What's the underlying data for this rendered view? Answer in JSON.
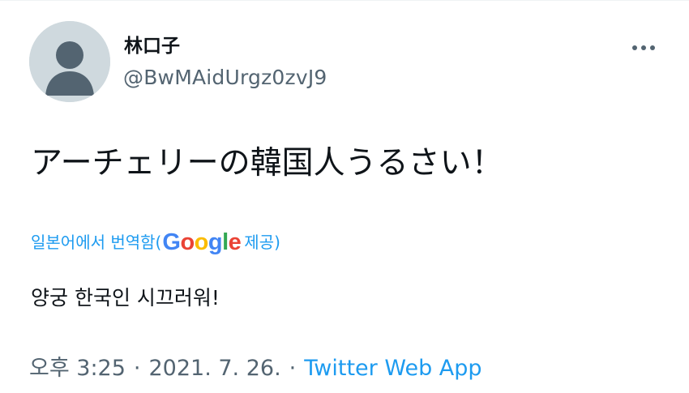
{
  "author": {
    "display_name": "林口子",
    "handle": "@BwMAidUrgz0zvJ9"
  },
  "tweet": {
    "text": "アーチェリーの韓国人うるさい！"
  },
  "translation": {
    "label": "일본어에서 번역함(",
    "google_letters": [
      "G",
      "o",
      "o",
      "g",
      "l",
      "e"
    ],
    "suffix": " 제공)",
    "text": "양궁 한국인 시끄러워!"
  },
  "meta": {
    "time": "오후 3:25",
    "separator": "·",
    "date": "2021. 7. 26.",
    "source": "Twitter Web App"
  },
  "colors": {
    "accent": "#1d9bf0",
    "secondary_text": "#536471",
    "primary_text": "#0f1419"
  },
  "icons": {
    "avatar": "default-profile-silhouette",
    "more": "more-horizontal-dots-icon"
  }
}
